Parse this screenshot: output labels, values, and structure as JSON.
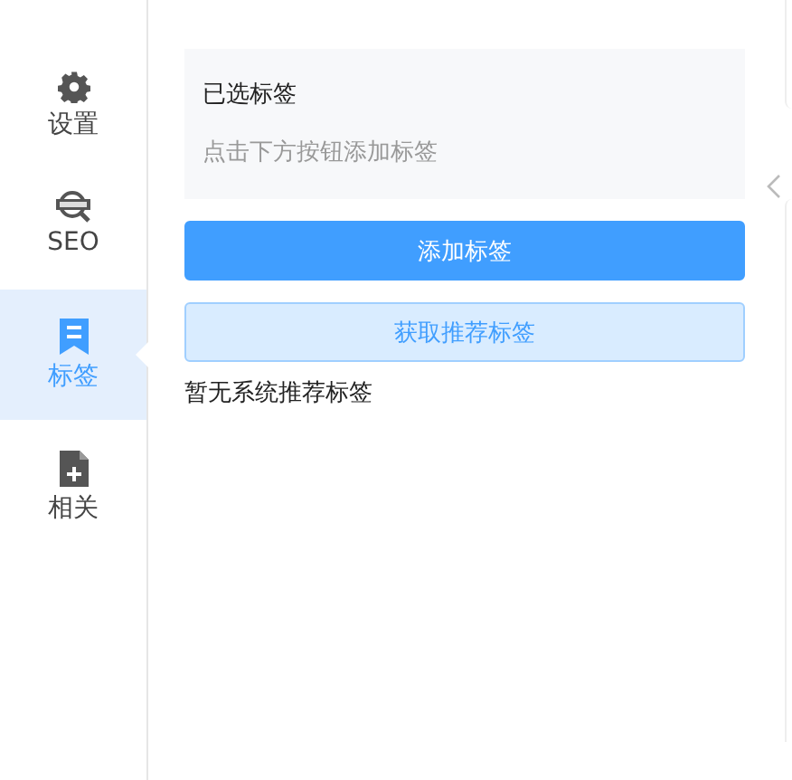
{
  "sidebar": {
    "items": [
      {
        "label": "设置",
        "selected": false
      },
      {
        "label": "SEO",
        "selected": false
      },
      {
        "label": "标签",
        "selected": true
      },
      {
        "label": "相关",
        "selected": false
      }
    ]
  },
  "selected_tags": {
    "title": "已选标签",
    "hint": "点击下方按钮添加标签"
  },
  "buttons": [
    {
      "label": "添加标签",
      "kind": "primary"
    },
    {
      "label": "获取推荐标签",
      "kind": "plain"
    }
  ],
  "recommend_message": "暂无系统推荐标签"
}
